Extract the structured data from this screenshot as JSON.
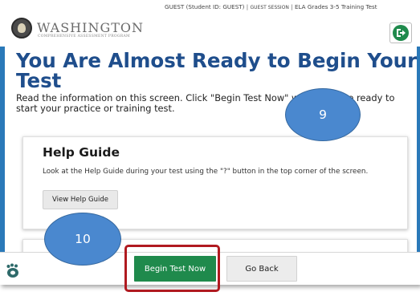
{
  "header": {
    "logo_title": "WASHINGTON",
    "logo_subtitle": "COMPREHENSIVE ASSESSMENT PROGRAM",
    "user": "GUEST (Student ID: GUEST)",
    "session": "GUEST SESSION",
    "test_name": "ELA Grades 3-5 Training Test",
    "separator": "|",
    "exit_icon": "exit-icon"
  },
  "main": {
    "title": "You Are Almost Ready to Begin Your Test",
    "intro": "Read the information on this screen. Click \"Begin Test Now\" when you are ready to start your practice or training test."
  },
  "help_card": {
    "title": "Help Guide",
    "text": "Look at the Help Guide during your test using the \"?\" button in the top corner of the screen.",
    "button": "View Help Guide"
  },
  "footer": {
    "begin_button": "Begin Test Now",
    "back_button": "Go Back",
    "left_icon": "bear-paw-icon"
  },
  "annotations": {
    "callout_9": "9",
    "callout_10": "10",
    "highlight_color": "#b01a20",
    "callout_color": "#4a88cf"
  },
  "colors": {
    "title_blue": "#1f4e8c",
    "panel_blue": "#2a79b9",
    "primary_green": "#1f8a4c"
  }
}
